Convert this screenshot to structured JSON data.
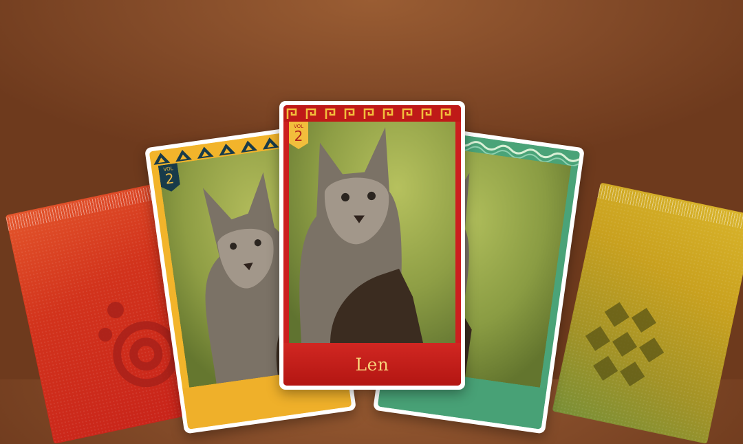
{
  "packs": [
    {
      "id": "left",
      "color": "#d2331c",
      "emblem": "sun-spiral-emblem"
    },
    {
      "id": "right",
      "color": "#c9a11f",
      "emblem": "cross-knot-emblem"
    }
  ],
  "cards": {
    "left": {
      "vol_label": "VOL",
      "vol_number": "2",
      "border_pattern": "triangle-spiral-pattern",
      "color": "#f2b42b"
    },
    "center": {
      "vol_label": "VOL",
      "vol_number": "2",
      "name": "Len",
      "border_pattern": "greek-key-pattern",
      "color": "#cc1f1f"
    },
    "right": {
      "border_pattern": "wave-pattern",
      "color": "#4aa378"
    }
  },
  "photo_subject": "cougar-cub-image",
  "background_color": "#864d2a"
}
